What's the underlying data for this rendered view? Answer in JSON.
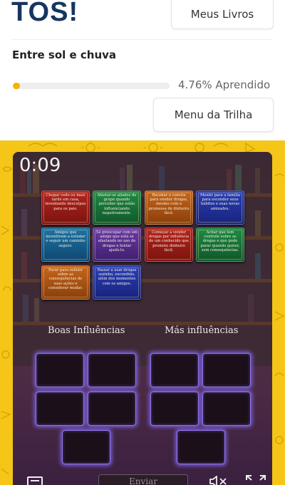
{
  "header": {
    "logo_text": "TOS",
    "logo_bang": "!",
    "my_books_label": "Meus Livros"
  },
  "course": {
    "title": "Entre sol e chuva",
    "progress_percent": 4.76,
    "progress_label": "4.76% Aprendido",
    "trail_menu_label": "Menu da Trilha"
  },
  "game": {
    "timer": "0:09",
    "cards": [
      {
        "text": "Chegar cedo ou mais tarde em casa, inventando desculpas para os pais.",
        "color": "#b3241e"
      },
      {
        "text": "Afastar-se aliados do grupo quando perceber que estão influenciando negativamente.",
        "color": "#1f8a45"
      },
      {
        "text": "Receber o convite para vender drogas, mesmo com a promessa de dinheiro fácil.",
        "color": "#c7661c"
      },
      {
        "text": "Mentir para a família para esconder seus hábitos e suas novas amizades.",
        "color": "#2a3fb8"
      },
      {
        "text": "Amigos que incentivam a estudar e seguir um caminho seguro.",
        "color": "#1d74a6"
      },
      {
        "text": "Se preocupar com um amigo que está se afastando no uso de drogas e tentar ajudá-lo.",
        "color": "#6a3aa6"
      },
      {
        "text": "Começar a vender drogas por influência de um conhecido que promete dinheiro fácil.",
        "color": "#b3241e"
      },
      {
        "text": "Achar que tem controle sobre as drogas e que pode parar quando quiser, sem consequências.",
        "color": "#1f8a45"
      },
      {
        "text": "Parar para refletir sobre as consequências de suas ações e considerar mudar.",
        "color": "#c7661c"
      },
      {
        "text": "Passar a usar drogas sozinho, escondido, além dos momentos com os amigos.",
        "color": "#2a3fb8"
      }
    ],
    "good_label": "Boas Influências",
    "bad_label": "Más influências",
    "send_label": "Enviar"
  },
  "icons": {
    "menu": "menu-icon",
    "sound": "sound-muted-icon",
    "fullscreen": "fullscreen-icon"
  },
  "colors": {
    "frame_yellow": "#f5c518",
    "progress_fill": "#f3b400",
    "logo_blue": "#16365f",
    "slot_glow": "#7b5ed8"
  }
}
